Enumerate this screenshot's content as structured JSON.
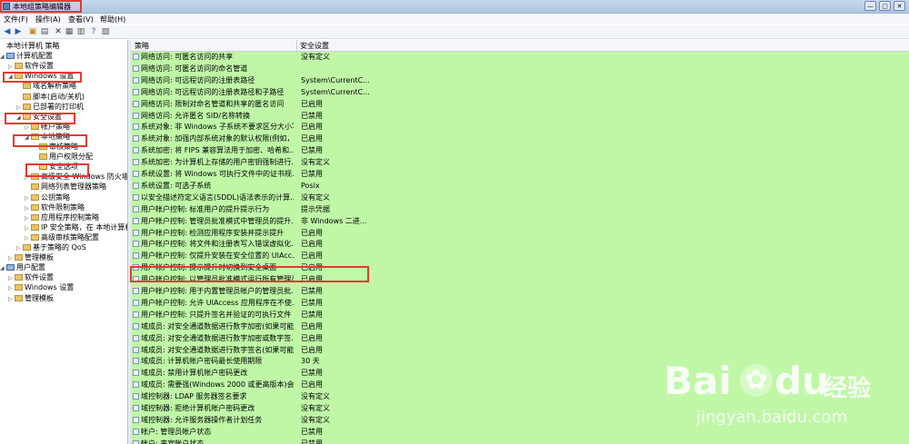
{
  "window": {
    "title": "本地组策略编辑器",
    "controls": [
      "—",
      "▢",
      "✕"
    ]
  },
  "menu": [
    "文件(F)",
    "操作(A)",
    "查看(V)",
    "帮助(H)"
  ],
  "toolbar": {
    "icons": [
      "back-arrow",
      "forward-arrow",
      "up-folder",
      "show-tree",
      "delete",
      "properties",
      "export",
      "help",
      "filter"
    ]
  },
  "tree": [
    {
      "label": "本地计算机 策略",
      "level": 0,
      "icon": "none",
      "expander": ""
    },
    {
      "label": "计算机配置",
      "level": 0,
      "icon": "comp",
      "expander": "◢"
    },
    {
      "label": "软件设置",
      "level": 1,
      "icon": "folder",
      "expander": "▷"
    },
    {
      "label": "Windows 设置",
      "level": 1,
      "icon": "folder",
      "expander": "◢"
    },
    {
      "label": "域名解析策略",
      "level": 2,
      "icon": "folder",
      "expander": ""
    },
    {
      "label": "脚本(启动/关机)",
      "level": 2,
      "icon": "folder",
      "expander": ""
    },
    {
      "label": "已部署的打印机",
      "level": 2,
      "icon": "folder",
      "expander": "▷"
    },
    {
      "label": "安全设置",
      "level": 2,
      "icon": "folder",
      "expander": "◢"
    },
    {
      "label": "帐户策略",
      "level": 3,
      "icon": "folder",
      "expander": "▷"
    },
    {
      "label": "本地策略",
      "level": 3,
      "icon": "open",
      "expander": "◢"
    },
    {
      "label": "审核策略",
      "level": 4,
      "icon": "folder",
      "expander": ""
    },
    {
      "label": "用户权限分配",
      "level": 4,
      "icon": "folder",
      "expander": ""
    },
    {
      "label": "安全选项",
      "level": 4,
      "icon": "lock",
      "expander": ""
    },
    {
      "label": "高级安全 Windows 防火墙",
      "level": 3,
      "icon": "folder",
      "expander": "▷"
    },
    {
      "label": "网络列表管理器策略",
      "level": 3,
      "icon": "folder",
      "expander": ""
    },
    {
      "label": "公钥策略",
      "level": 3,
      "icon": "folder",
      "expander": "▷"
    },
    {
      "label": "软件限制策略",
      "level": 3,
      "icon": "folder",
      "expander": "▷"
    },
    {
      "label": "应用程序控制策略",
      "level": 3,
      "icon": "folder",
      "expander": "▷"
    },
    {
      "label": "IP 安全策略，在 本地计算机",
      "level": 3,
      "icon": "folder",
      "expander": "▷"
    },
    {
      "label": "高级审核策略配置",
      "level": 3,
      "icon": "folder",
      "expander": "▷"
    },
    {
      "label": "基于策略的 QoS",
      "level": 2,
      "icon": "folder",
      "expander": "▷"
    },
    {
      "label": "管理模板",
      "level": 1,
      "icon": "folder",
      "expander": "▷"
    },
    {
      "label": "用户配置",
      "level": 0,
      "icon": "comp",
      "expander": "◢"
    },
    {
      "label": "软件设置",
      "level": 1,
      "icon": "folder",
      "expander": "▷"
    },
    {
      "label": "Windows 设置",
      "level": 1,
      "icon": "folder",
      "expander": "▷"
    },
    {
      "label": "管理模板",
      "level": 1,
      "icon": "folder",
      "expander": "▷"
    }
  ],
  "table": {
    "columns": [
      "策略",
      "安全设置"
    ],
    "rows": [
      {
        "policy": "网络访问: 可匿名访问的共享",
        "setting": "没有定义"
      },
      {
        "policy": "网络访问: 可匿名访问的命名管道",
        "setting": ""
      },
      {
        "policy": "网络访问: 可远程访问的注册表路径",
        "setting": "System\\CurrentC..."
      },
      {
        "policy": "网络访问: 可远程访问的注册表路径和子路径",
        "setting": "System\\CurrentC..."
      },
      {
        "policy": "网络访问: 限制对命名管道和共享的匿名访问",
        "setting": "已启用"
      },
      {
        "policy": "网络访问: 允许匿名 SID/名称转换",
        "setting": "已禁用"
      },
      {
        "policy": "系统对象: 非 Windows 子系统不要求区分大小写",
        "setting": "已启用"
      },
      {
        "policy": "系统对象: 加强内部系统对象的默认权限(例如，...",
        "setting": "已启用"
      },
      {
        "policy": "系统加密: 将 FIPS 兼容算法用于加密、哈希和...",
        "setting": "已禁用"
      },
      {
        "policy": "系统加密: 为计算机上存储的用户密钥强制进行...",
        "setting": "没有定义"
      },
      {
        "policy": "系统设置: 将 Windows 可执行文件中的证书规...",
        "setting": "已禁用"
      },
      {
        "policy": "系统设置: 可选子系统",
        "setting": "Posix"
      },
      {
        "policy": "以安全描述符定义语言(SDDL)语法表示的计算...",
        "setting": "没有定义"
      },
      {
        "policy": "用户帐户控制: 标准用户的提升提示行为",
        "setting": "提示凭据"
      },
      {
        "policy": "用户帐户控制: 管理员批准模式中管理员的提升...",
        "setting": "非 Windows 二进..."
      },
      {
        "policy": "用户帐户控制: 检测应用程序安装并提示提升",
        "setting": "已启用"
      },
      {
        "policy": "用户帐户控制: 将文件和注册表写入错误虚拟化...",
        "setting": "已启用"
      },
      {
        "policy": "用户帐户控制: 仅提升安装在安全位置的 UIAcc...",
        "setting": "已启用"
      },
      {
        "policy": "用户帐户控制: 提示提升时切换到安全桌面",
        "setting": "已启用"
      },
      {
        "policy": "用户帐户控制: 以管理员批准模式运行所有管理员",
        "setting": "已启用"
      },
      {
        "policy": "用户帐户控制: 用于内置管理员帐户的管理员批...",
        "setting": "已禁用"
      },
      {
        "policy": "用户帐户控制: 允许 UIAccess 应用程序在不使...",
        "setting": "已禁用"
      },
      {
        "policy": "用户帐户控制: 只提升签名并验证的可执行文件",
        "setting": "已禁用"
      },
      {
        "policy": "域成员: 对安全通道数据进行数字加密(如果可能)",
        "setting": "已启用"
      },
      {
        "policy": "域成员: 对安全通道数据进行数字加密或数字签...",
        "setting": "已启用"
      },
      {
        "policy": "域成员: 对安全通道数据进行数字签名(如果可能)",
        "setting": "已启用"
      },
      {
        "policy": "域成员: 计算机帐户密码最长使用期限",
        "setting": "30 天"
      },
      {
        "policy": "域成员: 禁用计算机帐户密码更改",
        "setting": "已禁用"
      },
      {
        "policy": "域成员: 需要强(Windows 2000 或更高版本)会...",
        "setting": "已启用"
      },
      {
        "policy": "域控制器: LDAP 服务器签名要求",
        "setting": "没有定义"
      },
      {
        "policy": "域控制器: 拒绝计算机帐户密码更改",
        "setting": "没有定义"
      },
      {
        "policy": "域控制器: 允许服务器操作者计划任务",
        "setting": "没有定义"
      },
      {
        "policy": "帐户: 管理员帐户状态",
        "setting": "已禁用"
      },
      {
        "policy": "帐户: 来宾帐户状态",
        "setting": "已禁用"
      }
    ]
  },
  "highlight_color": "#e53935",
  "table_bg": "#bff7a7",
  "watermark": {
    "brand": "Bai",
    "brand2": "du",
    "cn": "经验",
    "url": "jingyan.baidu.com"
  }
}
